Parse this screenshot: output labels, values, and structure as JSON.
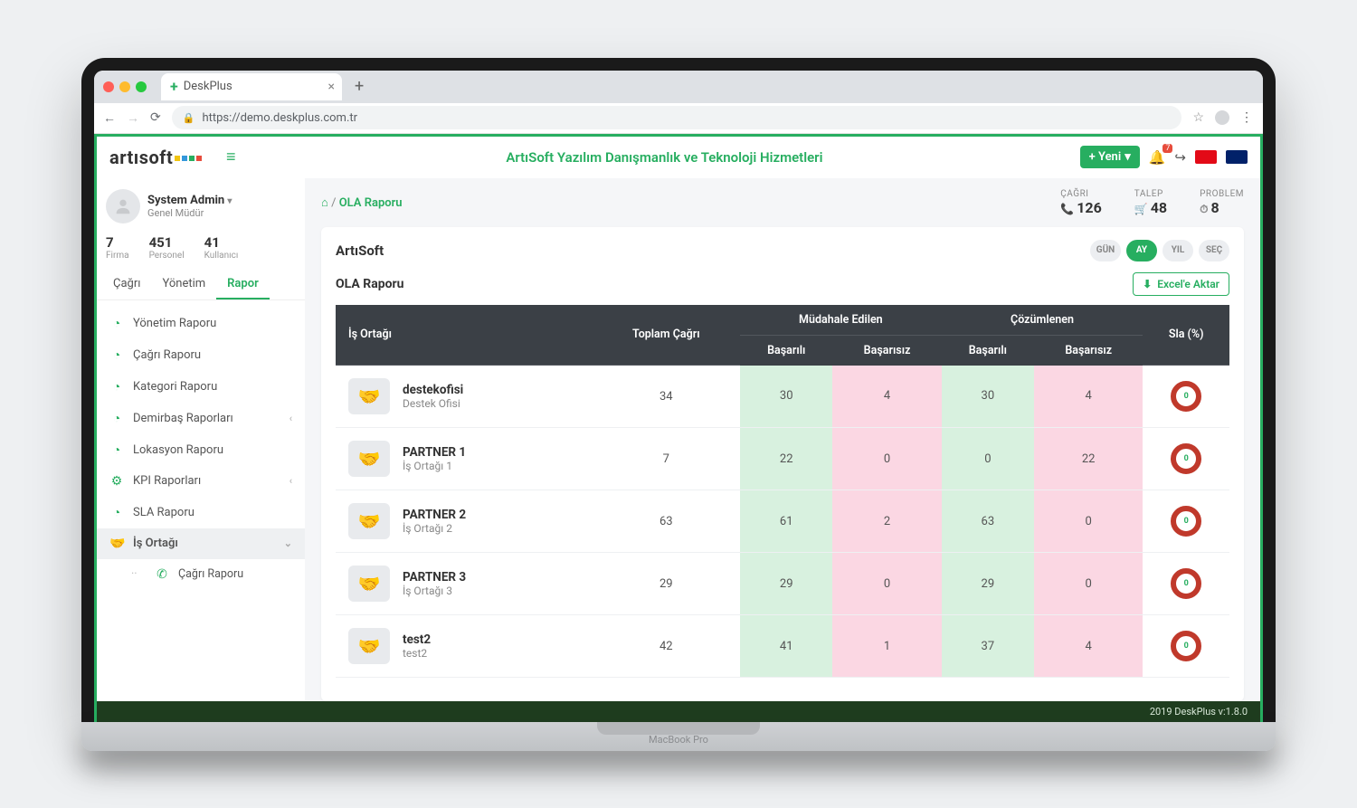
{
  "browser": {
    "tab_title": "DeskPlus",
    "url": "https://demo.deskplus.com.tr",
    "laptop_brand": "MacBook Pro"
  },
  "header": {
    "logo_text": "artısoft",
    "company_title": "ArtıSoft Yazılım Danışmanlık ve Teknoloji Hizmetleri",
    "new_button": "+ Yeni",
    "notification_badge": "7"
  },
  "sidebar": {
    "user_name": "System Admin",
    "user_role": "Genel Müdür",
    "stats": [
      {
        "value": "7",
        "label": "Firma"
      },
      {
        "value": "451",
        "label": "Personel"
      },
      {
        "value": "41",
        "label": "Kullanıcı"
      }
    ],
    "tabs": {
      "cagri": "Çağrı",
      "yonetim": "Yönetim",
      "rapor": "Rapor"
    },
    "menu": [
      {
        "icon": "pie",
        "label": "Yönetim Raporu"
      },
      {
        "icon": "pie",
        "label": "Çağrı Raporu"
      },
      {
        "icon": "pie",
        "label": "Kategori Raporu"
      },
      {
        "icon": "pie",
        "label": "Demirbaş Raporları",
        "chev": "‹"
      },
      {
        "icon": "pie",
        "label": "Lokasyon Raporu"
      },
      {
        "icon": "gear",
        "label": "KPI Raporları",
        "chev": "‹"
      },
      {
        "icon": "pie",
        "label": "SLA Raporu"
      },
      {
        "icon": "handshake",
        "label": "İş Ortağı",
        "chev": "⌄",
        "active": true
      },
      {
        "icon": "phone",
        "label": "Çağrı Raporu",
        "sub": true
      }
    ]
  },
  "main": {
    "breadcrumb_sep": " / ",
    "breadcrumb_current": "OLA Raporu",
    "kpis": [
      {
        "label": "ÇAĞRI",
        "icon": "📞",
        "value": "126"
      },
      {
        "label": "TALEP",
        "icon": "🛒",
        "value": "48"
      },
      {
        "label": "PROBLEM",
        "icon": "⏱",
        "value": "8"
      }
    ],
    "card_title": "ArtıSoft",
    "segments": {
      "gun": "GÜN",
      "ay": "AY",
      "yil": "YIL",
      "sec": "SEÇ"
    },
    "subtitle": "OLA Raporu",
    "export_btn": "Excel'e Aktar",
    "export_icon": "⬇",
    "columns": {
      "partner": "İş Ortağı",
      "total": "Toplam Çağrı",
      "mudahale": "Müdahale Edilen",
      "cozum": "Çözümlenen",
      "basarili": "Başarılı",
      "basarisiz": "Başarısız",
      "sla": "Sla (%)"
    },
    "rows": [
      {
        "name": "destekofisi",
        "sub": "Destek Ofisi",
        "total": "34",
        "m_ok": "30",
        "m_bad": "4",
        "c_ok": "30",
        "c_bad": "4",
        "sla": "0"
      },
      {
        "name": "PARTNER 1",
        "sub": "İş Ortağı 1",
        "total": "7",
        "m_ok": "22",
        "m_bad": "0",
        "c_ok": "0",
        "c_bad": "22",
        "sla": "0"
      },
      {
        "name": "PARTNER 2",
        "sub": "İş Ortağı 2",
        "total": "63",
        "m_ok": "61",
        "m_bad": "2",
        "c_ok": "63",
        "c_bad": "0",
        "sla": "0"
      },
      {
        "name": "PARTNER 3",
        "sub": "İş Ortağı 3",
        "total": "29",
        "m_ok": "29",
        "m_bad": "0",
        "c_ok": "29",
        "c_bad": "0",
        "sla": "0"
      },
      {
        "name": "test2",
        "sub": "test2",
        "total": "42",
        "m_ok": "41",
        "m_bad": "1",
        "c_ok": "37",
        "c_bad": "4",
        "sla": "0"
      }
    ]
  },
  "footer": "2019 DeskPlus v:1.8.0"
}
